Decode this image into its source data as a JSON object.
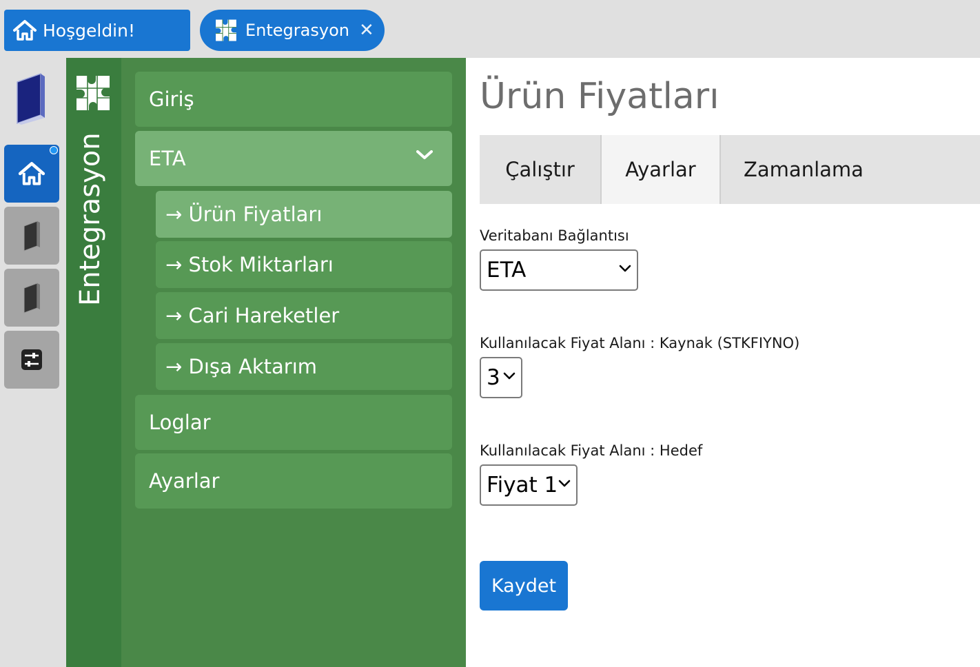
{
  "top_tabs": {
    "home_label": "Hoşgeldin!",
    "integration_label": "Entegrasyon",
    "close_symbol": "✕"
  },
  "rail": {
    "icons": [
      "book-icon",
      "home-icon",
      "book-icon",
      "book-icon",
      "sliders-icon"
    ]
  },
  "band": {
    "title": "Entegrasyon",
    "icon": "puzzle-icon"
  },
  "menu": {
    "items": [
      {
        "label": "Giriş"
      },
      {
        "label": "ETA",
        "expanded": true
      },
      {
        "label": "Loglar"
      },
      {
        "label": "Ayarlar"
      }
    ],
    "sub_items": [
      {
        "label": "→ Ürün Fiyatları",
        "active": true
      },
      {
        "label": "→ Stok Miktarları"
      },
      {
        "label": "→ Cari Hareketler"
      },
      {
        "label": "→ Dışa Aktarım"
      }
    ]
  },
  "main": {
    "title": "Ürün Fiyatları",
    "tabs": [
      {
        "label": "Çalıştır"
      },
      {
        "label": "Ayarlar",
        "active": true
      },
      {
        "label": "Zamanlama"
      }
    ],
    "form": {
      "db_label": "Veritabanı Bağlantısı",
      "db_value": "ETA",
      "source_label": "Kullanılacak Fiyat Alanı : Kaynak (STKFIYNO)",
      "source_value": "3",
      "target_label": "Kullanılacak Fiyat Alanı : Hedef",
      "target_value": "Fiyat 1",
      "save_label": "Kaydet"
    }
  },
  "colors": {
    "primary_blue": "#1976d2",
    "band_green": "#3a7d3e",
    "menu_green": "#4a8848",
    "item_green": "#579955",
    "active_green": "#77b276"
  }
}
